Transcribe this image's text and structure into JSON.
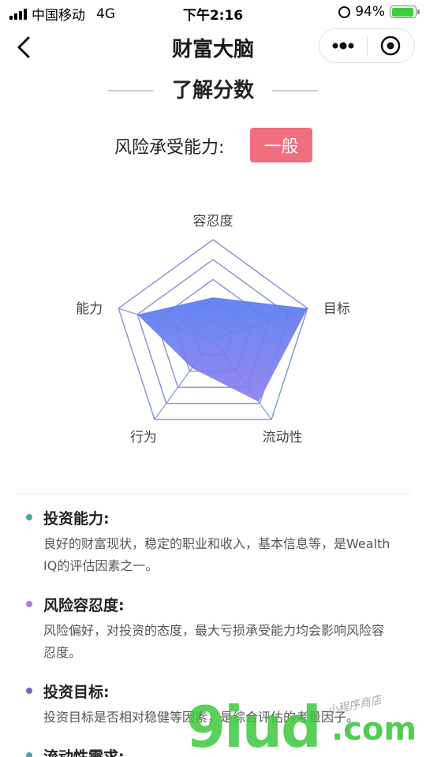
{
  "status_bar": {
    "carrier": "中国移动",
    "network": "4G",
    "time": "下午2:16",
    "battery_percent": "94%",
    "battery_level": 0.94
  },
  "nav": {
    "title": "财富大脑",
    "back_icon": "chevron-left-icon",
    "more_icon": "more-dots-icon",
    "close_icon": "target-circle-icon"
  },
  "section": {
    "title": "了解分数"
  },
  "risk": {
    "label": "风险承受能力:",
    "value": "一般",
    "badge_color": "#ef6f7f"
  },
  "chart_data": {
    "type": "radar",
    "axes": [
      "容忍度",
      "目标",
      "流动性",
      "行为",
      "能力"
    ],
    "max": 5,
    "values": [
      2.1,
      5.0,
      3.9,
      1.8,
      4.0
    ],
    "fill_color": "#5b7ff2",
    "grid_color": "#8a8fc8"
  },
  "items": [
    {
      "heading": "投资能力:",
      "desc": "良好的财富现状，稳定的职业和收入，基本信息等，是Wealth IQ的评估因素之一。",
      "dot_color": "#4aa6a0"
    },
    {
      "heading": "风险容忍度:",
      "desc": "风险偏好，对投资的态度，最大亏损承受能力均会影响风险容忍度。",
      "dot_color": "#b07ad0"
    },
    {
      "heading": "投资目标:",
      "desc": "投资目标是否相对稳健等因素，是综合评估的考量因子。",
      "dot_color": "#7a63b8"
    },
    {
      "heading": "流动性需求:",
      "desc": "",
      "dot_color": "#5a9aa8"
    }
  ],
  "watermark": {
    "main": "9iud",
    "suffix": ".com",
    "small": "小程序商店"
  }
}
